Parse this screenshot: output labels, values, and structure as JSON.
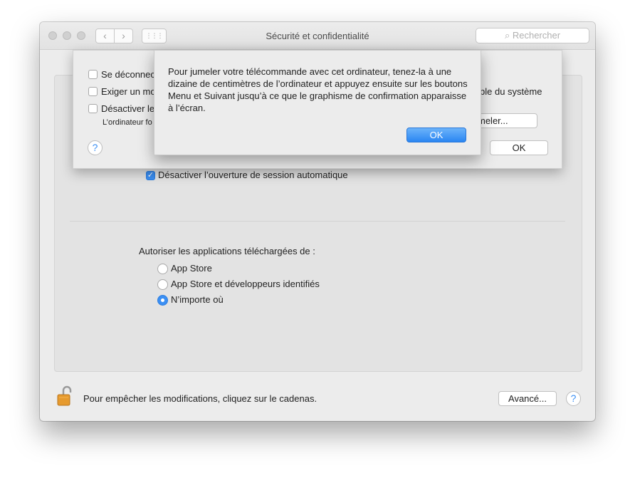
{
  "window": {
    "title": "Sécurité et confidentialité",
    "back_icon": "‹",
    "forward_icon": "›",
    "grid_icon": "⋮⋮⋮",
    "search_placeholder": "Rechercher",
    "search_icon": "⌕"
  },
  "general": {
    "auto_login_label": "Désactiver l’ouverture de session automatique",
    "auto_login_checked": true,
    "downloads_title": "Autoriser les applications téléchargées de :",
    "options": [
      {
        "label": "App Store",
        "selected": false
      },
      {
        "label": "App Store et développeurs identifiés",
        "selected": false
      },
      {
        "label": "N’importe où",
        "selected": true
      }
    ]
  },
  "sheet": {
    "check1": "Se déconnec",
    "check2": "Exiger un mo",
    "check2_tail": "ble du système",
    "check3": "Désactiver le",
    "note": "L’ordinateur fo",
    "pair_button": "meler...",
    "ok_button": "OK",
    "help": "?"
  },
  "alert": {
    "message": "Pour jumeler votre télécommande avec cet ordinateur, tenez-la à une dizaine de centimètres de l’ordinateur et appuyez ensuite sur les boutons Menu et Suivant jusqu’à ce que le graphisme de confirmation apparaisse à l’écran.",
    "ok_button": "OK"
  },
  "footer": {
    "lock_text": "Pour empêcher les modifications, cliquez sur le cadenas.",
    "advanced_button": "Avancé...",
    "help": "?"
  },
  "colors": {
    "accent": "#3b8ff3",
    "window_bg": "#ececec",
    "lock": "#e69a2e"
  }
}
